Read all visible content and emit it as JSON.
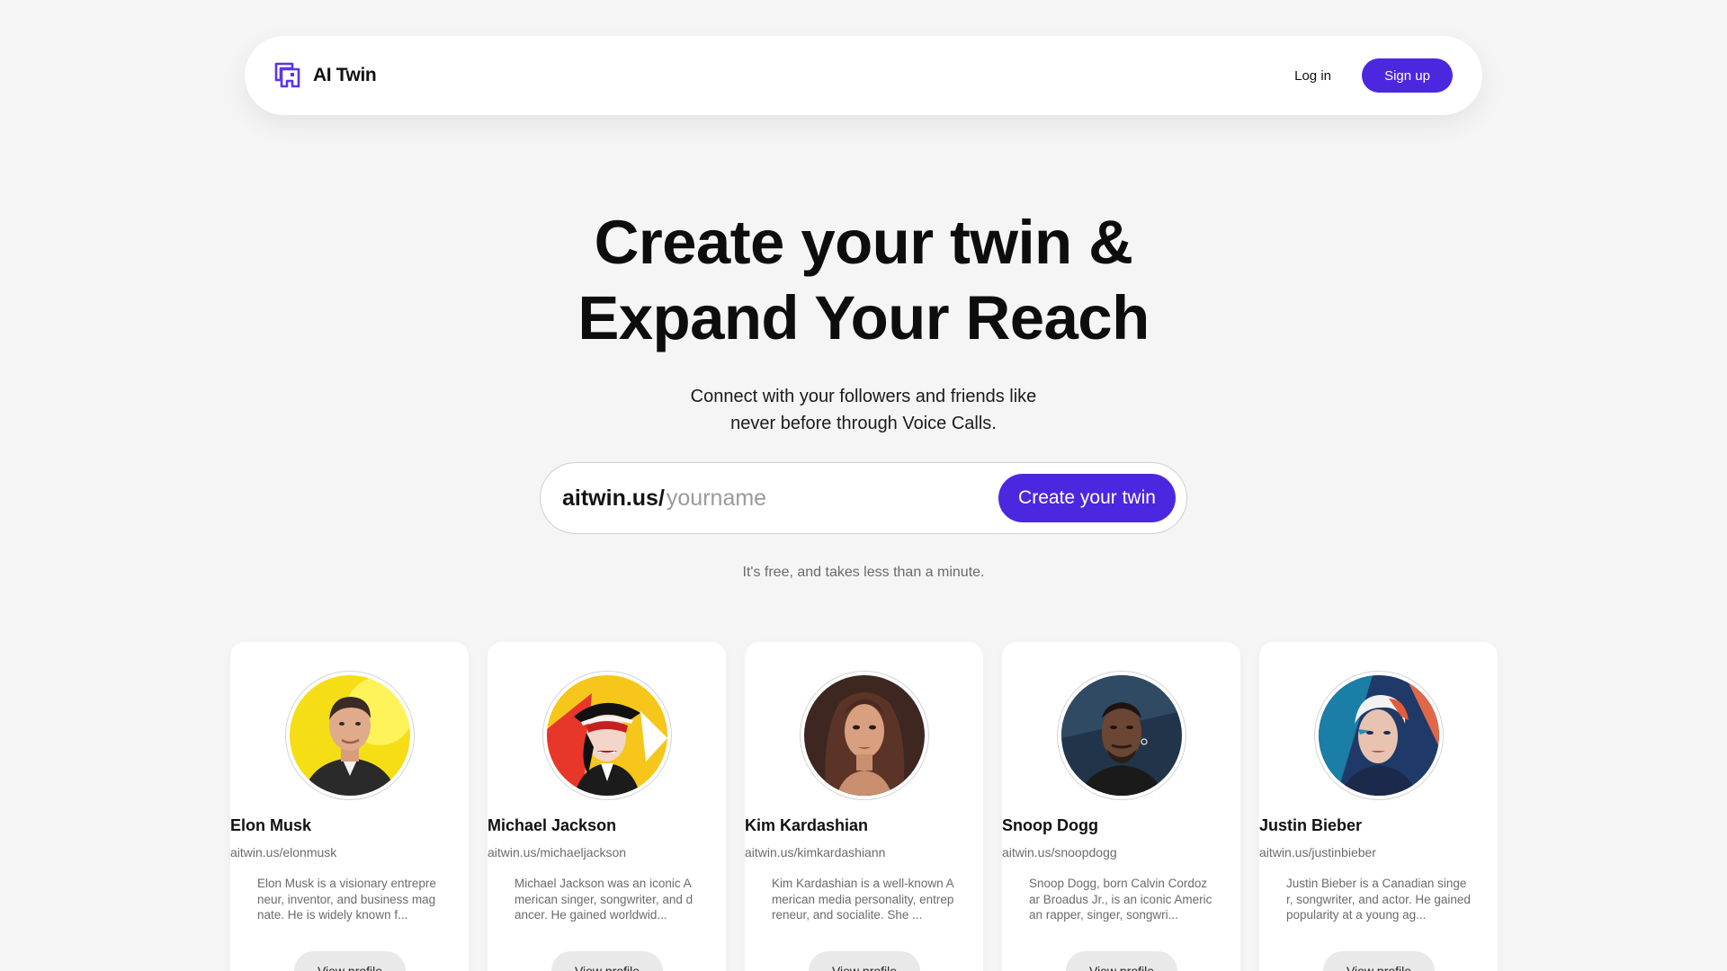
{
  "brand": {
    "name": "AI Twin",
    "logo_icon": "twin-logo-icon",
    "accent": "#4b28e0"
  },
  "nav": {
    "login_label": "Log in",
    "signup_label": "Sign up"
  },
  "hero": {
    "title_line1": "Create your twin &",
    "title_line2": "Expand Your Reach",
    "subtitle_line1": "Connect with your followers and friends like",
    "subtitle_line2": "never before through Voice Calls."
  },
  "claim": {
    "prefix": "aitwin.us/",
    "placeholder": "yourname",
    "button_label": "Create your twin"
  },
  "free_note": "It's free, and takes less than a minute.",
  "profiles": [
    {
      "name": "Elon Musk",
      "url": "aitwin.us/elonmusk",
      "description": "Elon Musk is a visionary entrepreneur, inventor, and business magnate. He is widely known f...",
      "button_label": "View profile"
    },
    {
      "name": "Michael Jackson",
      "url": "aitwin.us/michaeljackson",
      "description": "Michael Jackson was an iconic American singer, songwriter, and dancer. He gained worldwid...",
      "button_label": "View profile"
    },
    {
      "name": "Kim Kardashian",
      "url": "aitwin.us/kimkardashiann",
      "description": "Kim Kardashian is a well-known American media personality, entrepreneur, and socialite. She ...",
      "button_label": "View profile"
    },
    {
      "name": "Snoop Dogg",
      "url": "aitwin.us/snoopdogg",
      "description": "Snoop Dogg, born Calvin Cordozar Broadus Jr., is an iconic American rapper, singer, songwri...",
      "button_label": "View profile"
    },
    {
      "name": "Justin Bieber",
      "url": "aitwin.us/justinbieber",
      "description": "Justin Bieber is a Canadian singer, songwriter, and actor. He gained popularity at a young ag...",
      "button_label": "View profile"
    }
  ]
}
